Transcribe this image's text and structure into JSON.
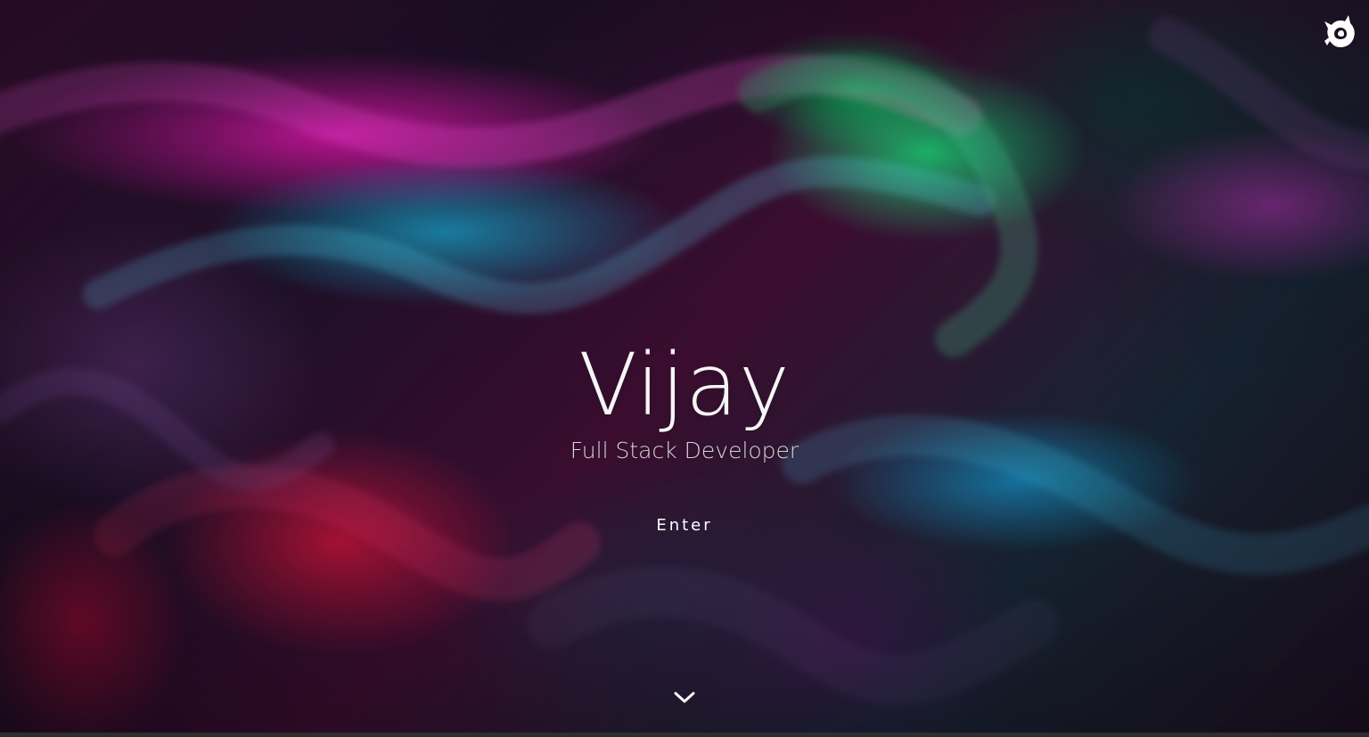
{
  "hero": {
    "title": "Vijay",
    "subtitle": "Full Stack Developer",
    "enter_label": "Enter"
  },
  "icons": {
    "brand": "cat-icon",
    "scroll": "chevron-down-icon"
  },
  "colors": {
    "text": "#ffffff",
    "subtitle": "#d8d5da",
    "background_dark": "#1b0f1f",
    "magenta": "#e223b0",
    "cyan": "#2dc8eb",
    "green": "#32ff96",
    "red": "#d21e41",
    "bottom_bar": "#2d2e30"
  }
}
